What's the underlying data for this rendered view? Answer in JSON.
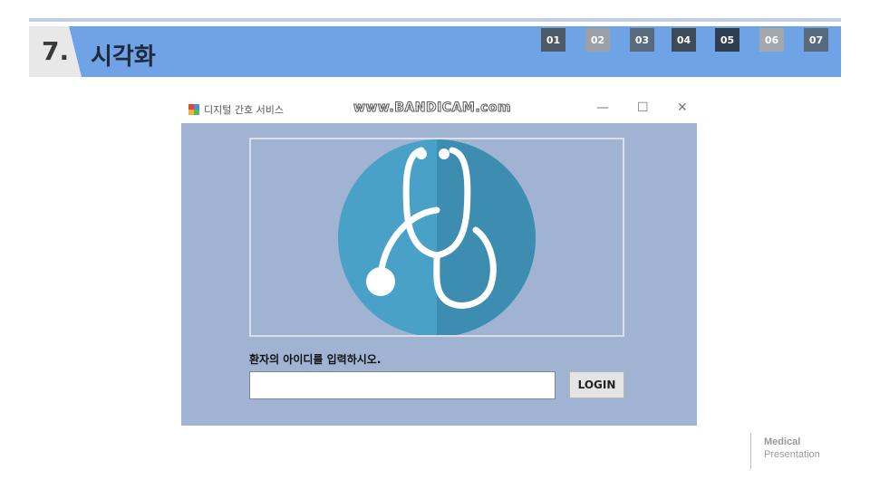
{
  "header": {
    "section_number": "7.",
    "section_title": "시각화",
    "nav_items": [
      {
        "label": "01",
        "color": "#4d5b69"
      },
      {
        "label": "02",
        "color": "#9aa0a6"
      },
      {
        "label": "03",
        "color": "#5a6b7f"
      },
      {
        "label": "04",
        "color": "#3d4a57"
      },
      {
        "label": "05",
        "color": "#2e3d4f"
      },
      {
        "label": "06",
        "color": "#a3a8ad"
      },
      {
        "label": "07",
        "color": "#586a7e"
      }
    ]
  },
  "window": {
    "title": "디지털 간호 서비스",
    "watermark": "www.BANDICAM.com",
    "controls": {
      "minimize": "—",
      "maximize": "☐",
      "close": "✕"
    },
    "image_icon": "stethoscope-icon",
    "prompt_label": "환자의 아이디를 입력하시오.",
    "id_input_value": "",
    "login_label": "LOGIN"
  },
  "footer": {
    "line1": "Medical",
    "line2": "Presentation"
  },
  "colors": {
    "header_bar": "#6fa3e6",
    "window_body": "#a0b3d2",
    "logo_circle": "#4aa1c8",
    "logo_shade": "#3d8db0"
  }
}
